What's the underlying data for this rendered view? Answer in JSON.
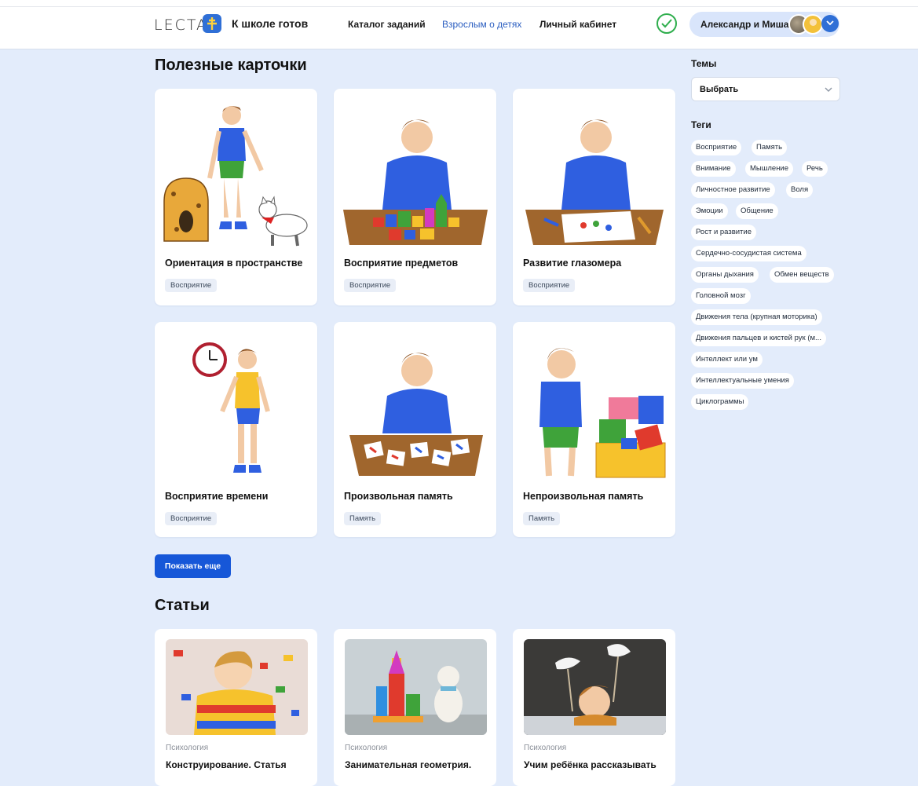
{
  "header": {
    "logo": "LECTA",
    "brand": "К школе готов",
    "nav": [
      "Каталог заданий",
      "Взрослым о детях",
      "Личный кабинет"
    ],
    "user": "Александр и Миша"
  },
  "cards_section": {
    "title": "Полезные карточки",
    "cards": [
      {
        "title": "Ориентация в пространстве",
        "tag": "Восприятие",
        "icon": "boy-cat-illustration"
      },
      {
        "title": "Восприятие предметов",
        "tag": "Восприятие",
        "icon": "boy-blocks-illustration"
      },
      {
        "title": "Развитие глазомера",
        "tag": "Восприятие",
        "icon": "boy-drawing-illustration"
      },
      {
        "title": "Восприятие времени",
        "tag": "Восприятие",
        "icon": "boy-clock-illustration"
      },
      {
        "title": "Произвольная память",
        "tag": "Память",
        "icon": "boy-letter-cards-illustration"
      },
      {
        "title": "Непроизвольная память",
        "tag": "Память",
        "icon": "boy-boxes-illustration"
      }
    ],
    "more_button": "Показать еще"
  },
  "articles_section": {
    "title": "Статьи",
    "articles": [
      {
        "category": "Психология",
        "title": "Конструирование. Статья"
      },
      {
        "category": "Психология",
        "title": "Занимательная геометрия."
      },
      {
        "category": "Психология",
        "title": "Учим ребёнка рассказывать"
      }
    ]
  },
  "sidebar": {
    "themes_label": "Темы",
    "select_value": "Выбрать",
    "tags_label": "Теги",
    "tags": [
      "Восприятие",
      "Память",
      "Внимание",
      "Мышление",
      "Речь",
      "Личностное развитие",
      "Воля",
      "Эмоции",
      "Общение",
      "Рост и развитие",
      "Сердечно-сосудистая система",
      "Органы дыхания",
      "Обмен веществ",
      "Головной мозг",
      "Движения тела (крупная моторика)",
      "Движения пальцев и кистей рук (м...",
      "Интеллект или ум",
      "Интеллектуальные умения",
      "Циклограммы"
    ]
  },
  "colors": {
    "accent": "#1657d8",
    "page_bg": "#e3ecfb",
    "check": "#2fae4d"
  }
}
